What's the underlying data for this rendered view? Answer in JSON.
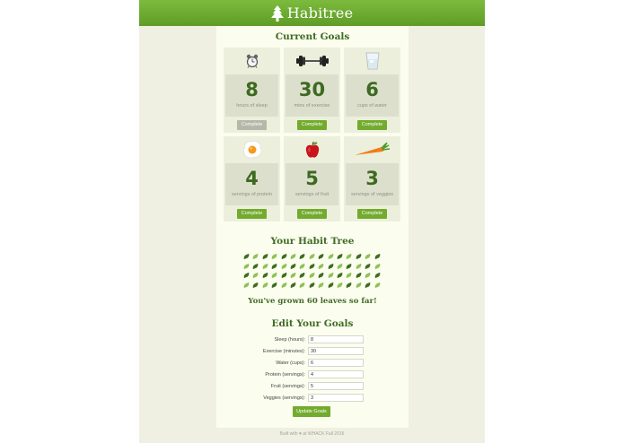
{
  "header": {
    "title": "Habitree",
    "icon": "tree-icon"
  },
  "goals_section": {
    "title": "Current Goals",
    "cards": [
      {
        "icon": "alarm-clock-icon",
        "value": "8",
        "label": "hours of sleep",
        "button": "Complete",
        "completed": true
      },
      {
        "icon": "dumbbell-icon",
        "value": "30",
        "label": "mins of exercise",
        "button": "Complete",
        "completed": false
      },
      {
        "icon": "water-glass-icon",
        "value": "6",
        "label": "cups of water",
        "button": "Complete",
        "completed": false
      },
      {
        "icon": "fried-egg-icon",
        "value": "4",
        "label": "servings of protein",
        "button": "Complete",
        "completed": false
      },
      {
        "icon": "apple-icon",
        "value": "5",
        "label": "servings of fruit",
        "button": "Complete",
        "completed": false
      },
      {
        "icon": "carrot-icon",
        "value": "3",
        "label": "servings of veggies",
        "button": "Complete",
        "completed": false
      }
    ]
  },
  "tree_section": {
    "title": "Your Habit Tree",
    "leaf_count": 60,
    "grown_text": "You've grown 60 leaves so far!",
    "leaf_colors": [
      "#3f6d22",
      "#8fc256"
    ]
  },
  "edit_section": {
    "title": "Edit Your Goals",
    "fields": [
      {
        "label": "Sleep (hours):",
        "value": "8"
      },
      {
        "label": "Exercise (minutes):",
        "value": "30"
      },
      {
        "label": "Water (cups):",
        "value": "6"
      },
      {
        "label": "Protein (servings):",
        "value": "4"
      },
      {
        "label": "Fruit (servings):",
        "value": "5"
      },
      {
        "label": "Veggies (servings):",
        "value": "3"
      }
    ],
    "submit_label": "Update Goals"
  },
  "footer": {
    "text": "Built with ♥ at WHACK Fall 2016"
  },
  "colors": {
    "accent": "#72ab2d",
    "header": "#6aab33",
    "title": "#3f6b23"
  }
}
